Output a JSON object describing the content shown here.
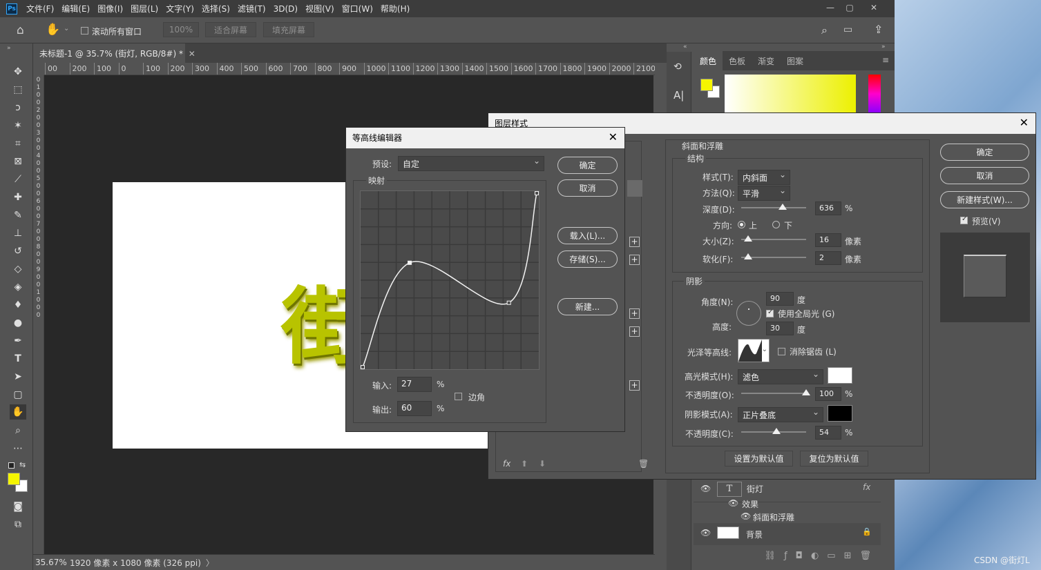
{
  "menubar": {
    "logo": "Ps",
    "items": [
      "文件(F)",
      "编辑(E)",
      "图像(I)",
      "图层(L)",
      "文字(Y)",
      "选择(S)",
      "滤镜(T)",
      "3D(D)",
      "视图(V)",
      "窗口(W)",
      "帮助(H)"
    ]
  },
  "optionsbar": {
    "scroll_all": "滚动所有窗口",
    "zoom": "100%",
    "fit_screen": "适合屏幕",
    "fill_screen": "填充屏幕"
  },
  "document": {
    "tab_title": "未标题-1 @ 35.7% (街灯, RGB/8#) *",
    "glyph": "街",
    "ruler_h": [
      "00",
      "200",
      "100",
      "0",
      "100",
      "200",
      "300",
      "400",
      "500",
      "600",
      "700",
      "800",
      "900",
      "1000",
      "1100",
      "1200",
      "1300",
      "1400",
      "1500",
      "1600",
      "1700",
      "1800",
      "1900",
      "2000",
      "2100"
    ],
    "ruler_v": "0\n1\n0\n0\n2\n0\n0\n3\n0\n0\n4\n0\n0\n5\n0\n0\n6\n0\n0\n7\n0\n0\n8\n0\n0\n9\n0\n0\n1\n0\n0\n0"
  },
  "status": {
    "zoom": "35.67%",
    "doc_info": "1920 像素 x 1080 像素 (326 ppi)",
    "arrow": "〉"
  },
  "color_panel": {
    "tabs": [
      "颜色",
      "色板",
      "渐变",
      "图案"
    ],
    "fg_color": "#f5f500",
    "bg_color": "#ffffff"
  },
  "layers": {
    "rows": [
      {
        "name": "街灯",
        "type": "T",
        "fx": "fx"
      },
      {
        "name": "效果"
      },
      {
        "name": "斜面和浮雕"
      },
      {
        "name": "背景"
      }
    ]
  },
  "layer_style": {
    "title": "图层样式",
    "section": "斜面和浮雕",
    "structure": "结构",
    "style_label": "样式(T):",
    "style_value": "内斜面",
    "technique_label": "方法(Q):",
    "technique_value": "平滑",
    "depth_label": "深度(D):",
    "depth_value": "636",
    "percent": "%",
    "direction_label": "方向:",
    "dir_up": "上",
    "dir_down": "下",
    "size_label": "大小(Z):",
    "size_value": "16",
    "px": "像素",
    "soften_label": "软化(F):",
    "soften_value": "2",
    "shading": "阴影",
    "angle_label": "角度(N):",
    "angle_value": "90",
    "deg": "度",
    "global_light": "使用全局光 (G)",
    "altitude_label": "高度:",
    "altitude_value": "30",
    "gloss_label": "光泽等高线:",
    "antialias": "消除锯齿 (L)",
    "hl_mode_label": "高光模式(H):",
    "hl_mode": "滤色",
    "hl_opacity_label": "不透明度(O):",
    "hl_opacity": "100",
    "sh_mode_label": "阴影模式(A):",
    "sh_mode": "正片叠底",
    "sh_opacity_label": "不透明度(C):",
    "sh_opacity": "54",
    "make_default": "设置为默认值",
    "reset_default": "复位为默认值",
    "ok": "确定",
    "cancel": "取消",
    "new_style": "新建样式(W)...",
    "preview": "预览(V)",
    "hl_color": "#ffffff",
    "sh_color": "#000000"
  },
  "contour_editor": {
    "title": "等高线编辑器",
    "preset_label": "预设:",
    "preset_value": "自定",
    "mapping": "映射",
    "ok": "确定",
    "cancel": "取消",
    "load": "载入(L)...",
    "save": "存储(S)...",
    "new": "新建...",
    "input_label": "输入:",
    "input_value": "27",
    "output_label": "输出:",
    "output_value": "60",
    "percent": "%",
    "corner": "边角",
    "curve_points": [
      [
        0,
        0
      ],
      [
        27,
        60
      ],
      [
        84,
        37
      ],
      [
        100,
        100
      ]
    ]
  },
  "watermark": "CSDN @街灯L"
}
